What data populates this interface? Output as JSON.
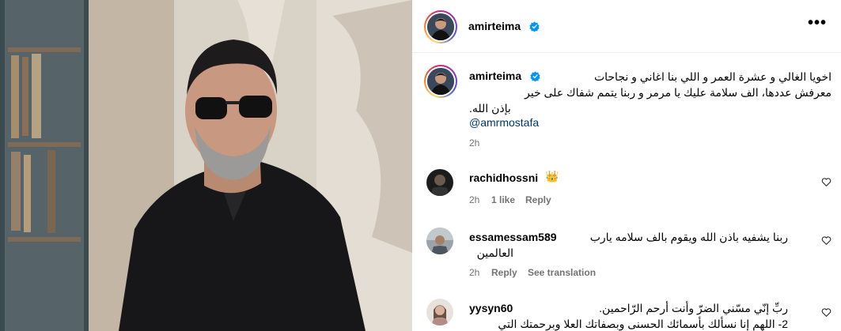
{
  "post": {
    "author": "amirteima",
    "more_label": "•••",
    "caption_user": "amirteima",
    "caption_lines": [
      "اخويا الغالي و عشرة العمر و اللي بنا اغاني و نجاحات",
      "معرفش عددها، الف سلامة عليك يا مرمر و ربنا يتمم شفاك على خير",
      "بإذن الله."
    ],
    "mention": "@amrmostafa",
    "time": "2h"
  },
  "comments": [
    {
      "user": "rachidhossni",
      "text": "👑",
      "time": "2h",
      "likes": "1 like",
      "reply": "Reply"
    },
    {
      "user": "essamessam589",
      "lines": [
        "ربنا يشفيه باذن الله ويقوم بالف سلامه يارب",
        "العالمين"
      ],
      "time": "2h",
      "reply": "Reply",
      "translate": "See translation"
    },
    {
      "user": "yysyn60",
      "lines": [
        "ربِّ إنّي مسّني الضرّ وأنت أرحم الرّاحمين.",
        "2- اللهم إنا نسألك بأسمائك الحسنى وبصفاتك العلا وبرحمتك التي"
      ]
    }
  ],
  "icons": {
    "verified": "verified-badge-icon",
    "heart": "heart-outline-icon",
    "more": "more-options-icon"
  },
  "colors": {
    "verified": "#0095f6",
    "link": "#00376b",
    "muted": "#737373"
  }
}
